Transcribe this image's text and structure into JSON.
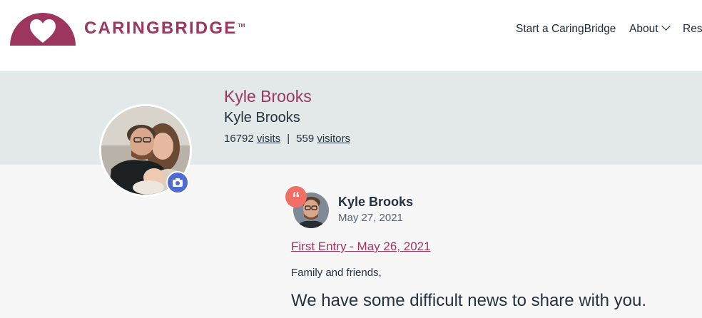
{
  "brand": {
    "name": "CARINGBRIDGE",
    "tm": "TM",
    "color": "#9c365f"
  },
  "nav": {
    "start": "Start a CaringBridge",
    "about": "About",
    "resources": "Resources"
  },
  "profile": {
    "site_title": "Kyle Brooks",
    "owner_name": "Kyle Brooks",
    "visits_count": "16792",
    "visits_label": "visits",
    "separator": "|",
    "visitors_count": "559",
    "visitors_label": "visitors"
  },
  "entry": {
    "author": "Kyle Brooks",
    "date": "May 27, 2021",
    "title": "First Entry - May 26, 2021",
    "greeting": "Family and friends,",
    "lead": "We have some difficult news to share with you."
  },
  "icons": {
    "camera": "camera-icon",
    "quote": "quote-icon",
    "chevron": "chevron-down-icon"
  }
}
